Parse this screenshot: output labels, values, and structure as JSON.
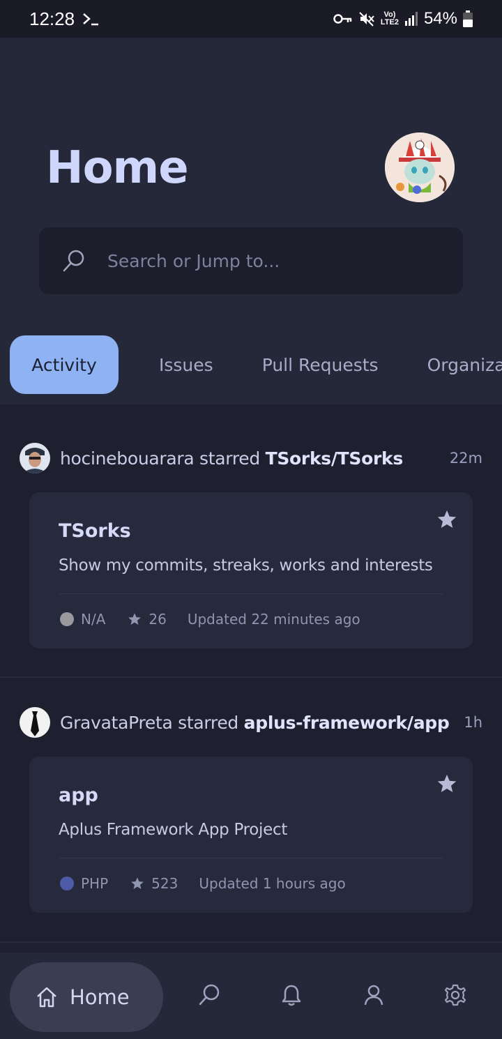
{
  "status_bar": {
    "time": "12:28",
    "battery": "54%",
    "volte_line1": "Vo)",
    "volte_line2": "LTE2"
  },
  "header": {
    "title": "Home",
    "search_placeholder": "Search or Jump to..."
  },
  "tabs": [
    {
      "label": "Activity",
      "active": true
    },
    {
      "label": "Issues",
      "active": false
    },
    {
      "label": "Pull Requests",
      "active": false
    },
    {
      "label": "Organizations",
      "active": false
    }
  ],
  "feed": [
    {
      "user": "hocinebouarara",
      "action": "starred",
      "repo_full": "TSorks/TSorks",
      "time": "22m",
      "repo_name": "TSorks",
      "description": "Show my commits, streaks, works and interests",
      "language": "N/A",
      "language_color": "#9a9a9a",
      "stars": "26",
      "updated": "Updated 22 minutes ago"
    },
    {
      "user": "GravataPreta",
      "action": "starred",
      "repo_full": "aplus-framework/app",
      "time": "1h",
      "repo_name": "app",
      "description": "Aplus Framework App Project",
      "language": "PHP",
      "language_color": "#4e5ba6",
      "stars": "523",
      "updated": "Updated 1 hours ago"
    }
  ],
  "bottom_nav": {
    "home_label": "Home",
    "items": [
      "home-icon",
      "search-icon",
      "bell-icon",
      "profile-icon",
      "settings-icon"
    ]
  },
  "colors": {
    "background": "#1e2030",
    "header": "#252838",
    "accent": "#8fb2f3",
    "card": "#262a3c"
  }
}
